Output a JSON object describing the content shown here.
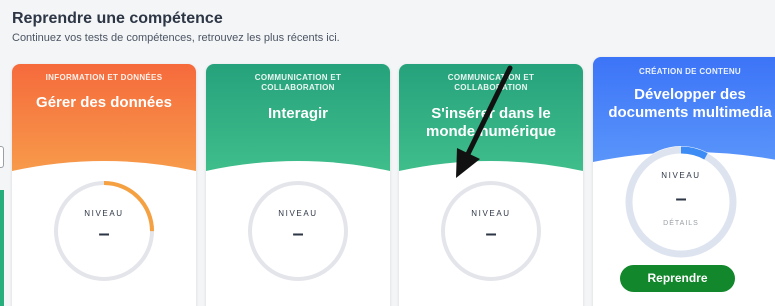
{
  "header": {
    "title": "Reprendre une compétence",
    "subtitle": "Continuez vos tests de compétences, retrouvez les plus récents ici."
  },
  "cards": [
    {
      "category": "INFORMATION ET DONNÉES",
      "skill": "Gérer des données",
      "level_label": "NIVEAU",
      "level_value": "–",
      "progress": 0.25,
      "color_top": "#f66a3c",
      "color_bottom": "#f7a04c"
    },
    {
      "category": "COMMUNICATION ET COLLABORATION",
      "skill": "Interagir",
      "level_label": "NIVEAU",
      "level_value": "–",
      "progress": 0,
      "color_top": "#26a27c",
      "color_bottom": "#42c18d"
    },
    {
      "category": "COMMUNICATION ET COLLABORATION",
      "skill": "S'insérer dans le monde numérique",
      "level_label": "NIVEAU",
      "level_value": "–",
      "progress": 0,
      "color_top": "#26a27c",
      "color_bottom": "#42c18d"
    },
    {
      "category": "CRÉATION DE CONTENU",
      "skill": "Développer des documents multimedia",
      "level_label": "NIVEAU",
      "level_value": "–",
      "detail_label": "DÉTAILS",
      "button_label": "Reprendre",
      "progress": 0.08,
      "color_top": "#3c74f7",
      "color_bottom": "#5d99fb"
    }
  ],
  "colors": {
    "arrow": "#111111",
    "button": "#12872b",
    "gauge_track": "#e4e5eb"
  },
  "icons": [
    "arrow-pointer-icon"
  ]
}
